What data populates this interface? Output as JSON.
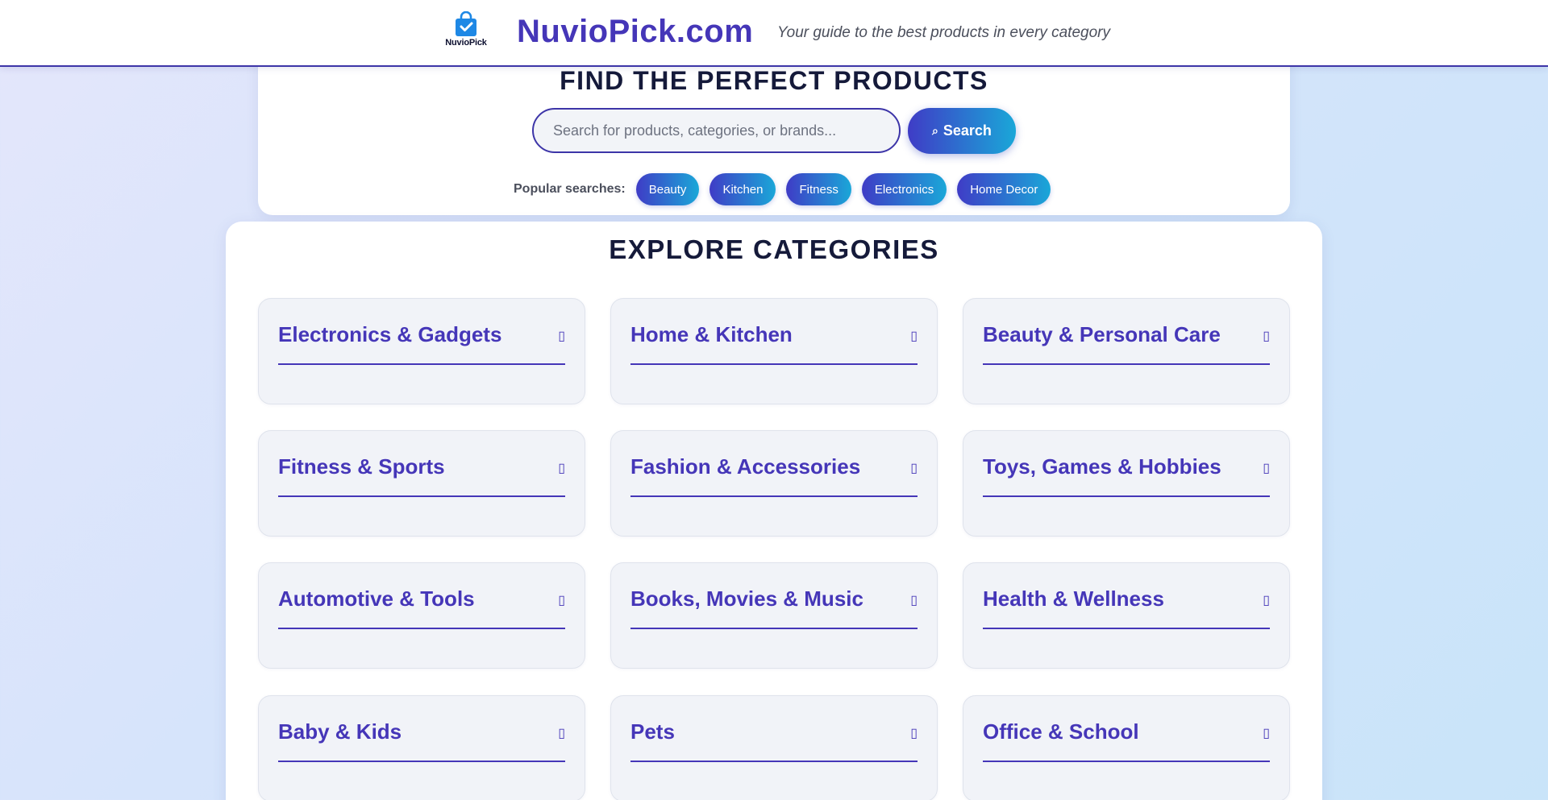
{
  "header": {
    "logo_text": "NuvioPick",
    "site_name": "NuvioPick.com",
    "tagline": "Your guide to the best products in every category"
  },
  "search": {
    "title": "FIND THE PERFECT PRODUCTS",
    "placeholder": "Search for products, categories, or brands...",
    "button_label": "Search",
    "button_icon": "search-icon",
    "popular_label": "Popular searches:",
    "popular": [
      "Beauty",
      "Kitchen",
      "Fitness",
      "Electronics",
      "Home Decor"
    ]
  },
  "categories": {
    "title": "EXPLORE CATEGORIES",
    "expand_icon": "chevron-icon",
    "items": [
      {
        "label": "Electronics & Gadgets"
      },
      {
        "label": "Home & Kitchen"
      },
      {
        "label": "Beauty & Personal Care"
      },
      {
        "label": "Fitness & Sports"
      },
      {
        "label": "Fashion & Accessories"
      },
      {
        "label": "Toys, Games & Hobbies"
      },
      {
        "label": "Automotive & Tools"
      },
      {
        "label": "Books, Movies & Music"
      },
      {
        "label": "Health & Wellness"
      },
      {
        "label": "Baby & Kids"
      },
      {
        "label": "Pets"
      },
      {
        "label": "Office & School"
      }
    ]
  },
  "colors": {
    "brand": "#4536b8",
    "gradient_start": "#3f3cc6",
    "gradient_end": "#1aa7d8",
    "logo_bag": "#1e88e5"
  }
}
